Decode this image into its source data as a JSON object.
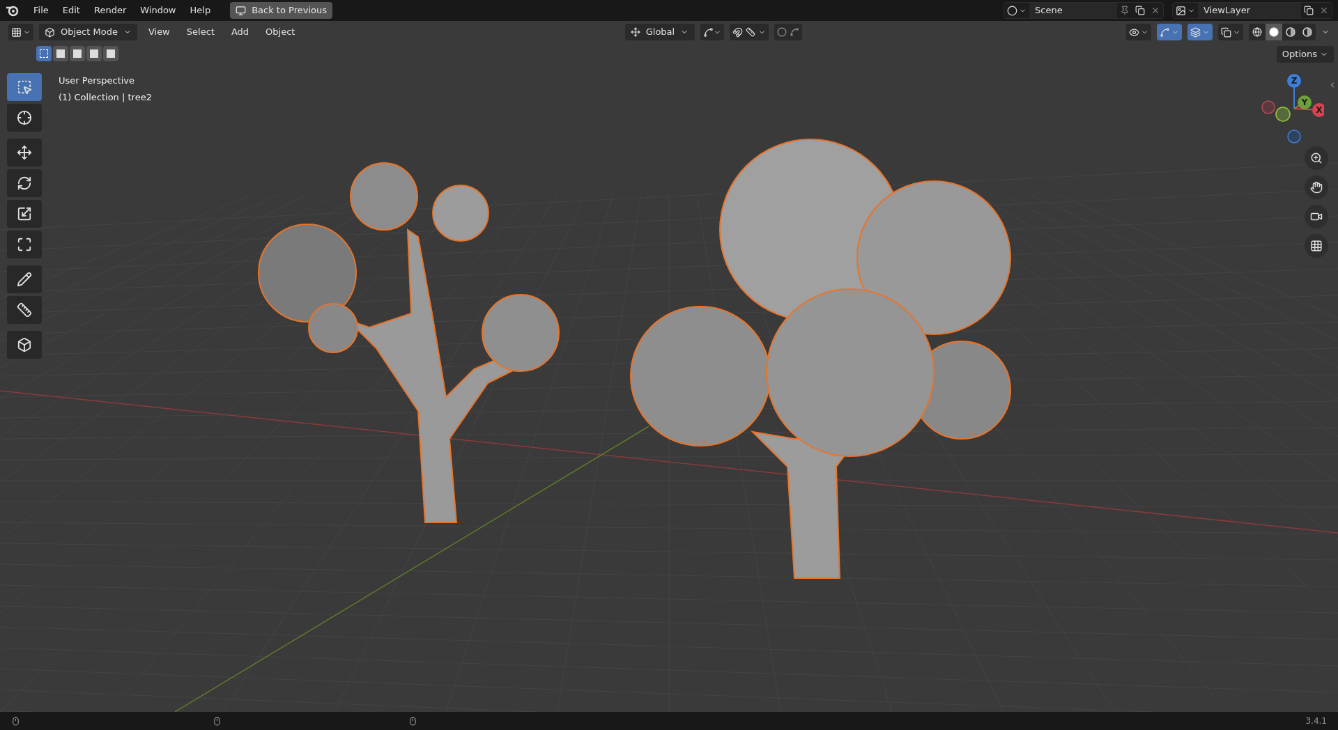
{
  "top_menu": [
    "File",
    "Edit",
    "Render",
    "Window",
    "Help"
  ],
  "back_button": "Back to Previous",
  "scene": {
    "name": "Scene"
  },
  "view_layer": {
    "name": "ViewLayer"
  },
  "header": {
    "mode": "Object Mode",
    "menus": [
      "View",
      "Select",
      "Add",
      "Object"
    ],
    "orientation": "Global",
    "toggles": [
      {
        "on": false
      },
      {
        "on": true
      },
      {
        "on": true
      },
      {
        "on": false
      }
    ],
    "shading": [
      {
        "selected": false
      },
      {
        "selected": true
      },
      {
        "selected": false
      },
      {
        "selected": false
      }
    ]
  },
  "selection_modes": [
    {
      "selected": true
    },
    {
      "selected": false
    },
    {
      "selected": false
    },
    {
      "selected": false
    },
    {
      "selected": false
    }
  ],
  "options": "Options",
  "overlay_text": [
    "User Perspective",
    "(1) Collection | tree2"
  ],
  "tools": [
    {
      "selected": true
    },
    {
      "selected": false
    },
    {
      "selected": false
    },
    {
      "selected": false
    },
    {
      "selected": false
    },
    {
      "selected": false
    },
    {
      "selected": false
    },
    {
      "selected": false
    },
    {
      "selected": false
    }
  ],
  "gizmo_axes": [
    "Z",
    "Y",
    "X"
  ],
  "status_bar": {
    "version": "3.4.1"
  }
}
